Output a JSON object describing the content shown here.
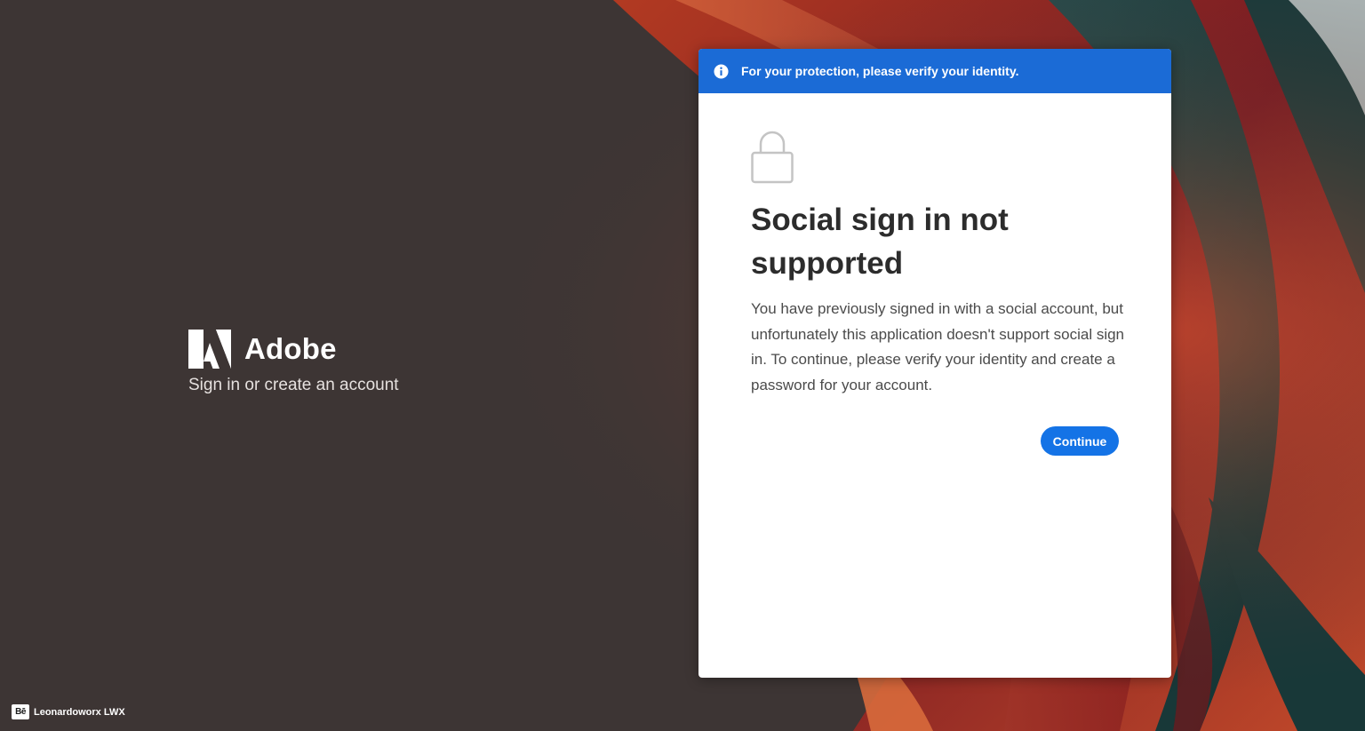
{
  "brand": {
    "name": "Adobe",
    "tagline": "Sign in or create an account"
  },
  "banner": {
    "icon": "info-icon",
    "text": "For your protection, please verify your identity."
  },
  "card": {
    "icon": "lock-icon",
    "title": "Social sign in not supported",
    "body": "You have previously signed in with a social account, but unfortunately this application doesn't support social sign in. To continue, please verify your identity and create a password for your account.",
    "continue_label": "Continue"
  },
  "credit": {
    "icon": "behance-icon",
    "icon_glyph": "Bē",
    "text": "Leonardoworx LWX"
  },
  "colors": {
    "background": "#3d3534",
    "banner": "#1b6bd6",
    "button": "#1473e6",
    "card": "#ffffff",
    "title": "#2c2c2c"
  }
}
